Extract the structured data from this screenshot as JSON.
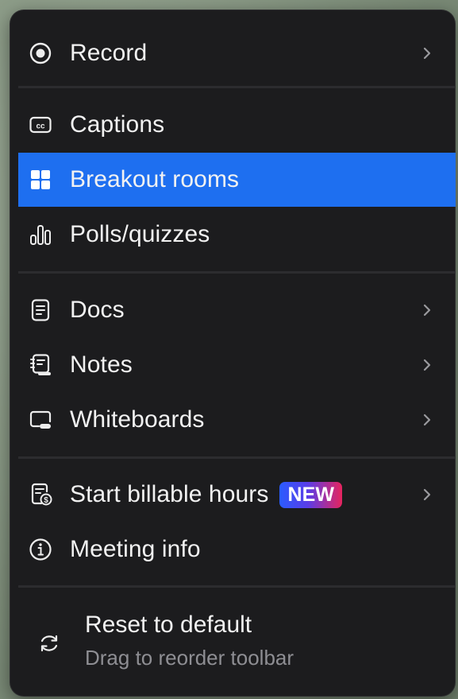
{
  "menu": {
    "items": [
      {
        "id": "record",
        "label": "Record",
        "icon": "record-icon",
        "has_submenu": true
      },
      {
        "id": "captions",
        "label": "Captions",
        "icon": "captions-icon",
        "has_submenu": false
      },
      {
        "id": "breakout-rooms",
        "label": "Breakout rooms",
        "icon": "grid-icon",
        "has_submenu": false,
        "selected": true
      },
      {
        "id": "polls",
        "label": "Polls/quizzes",
        "icon": "poll-bars-icon",
        "has_submenu": false
      },
      {
        "id": "docs",
        "label": "Docs",
        "icon": "document-icon",
        "has_submenu": true
      },
      {
        "id": "notes",
        "label": "Notes",
        "icon": "notes-icon",
        "has_submenu": true
      },
      {
        "id": "whiteboards",
        "label": "Whiteboards",
        "icon": "whiteboard-icon",
        "has_submenu": true
      },
      {
        "id": "billable-hours",
        "label": "Start billable hours",
        "icon": "billing-icon",
        "badge": "NEW",
        "has_submenu": true
      },
      {
        "id": "meeting-info",
        "label": "Meeting info",
        "icon": "info-icon",
        "has_submenu": false
      }
    ],
    "reset": {
      "title": "Reset to default",
      "subtitle": "Drag to reorder toolbar",
      "icon": "reset-arrows-icon"
    }
  },
  "colors": {
    "menu_background": "#1c1c1e",
    "selected": "#1e6ff0",
    "text": "#f2f2f2",
    "subtext": "#8e8e93",
    "badge_gradient": [
      "#2a5cff",
      "#e6245e"
    ]
  }
}
